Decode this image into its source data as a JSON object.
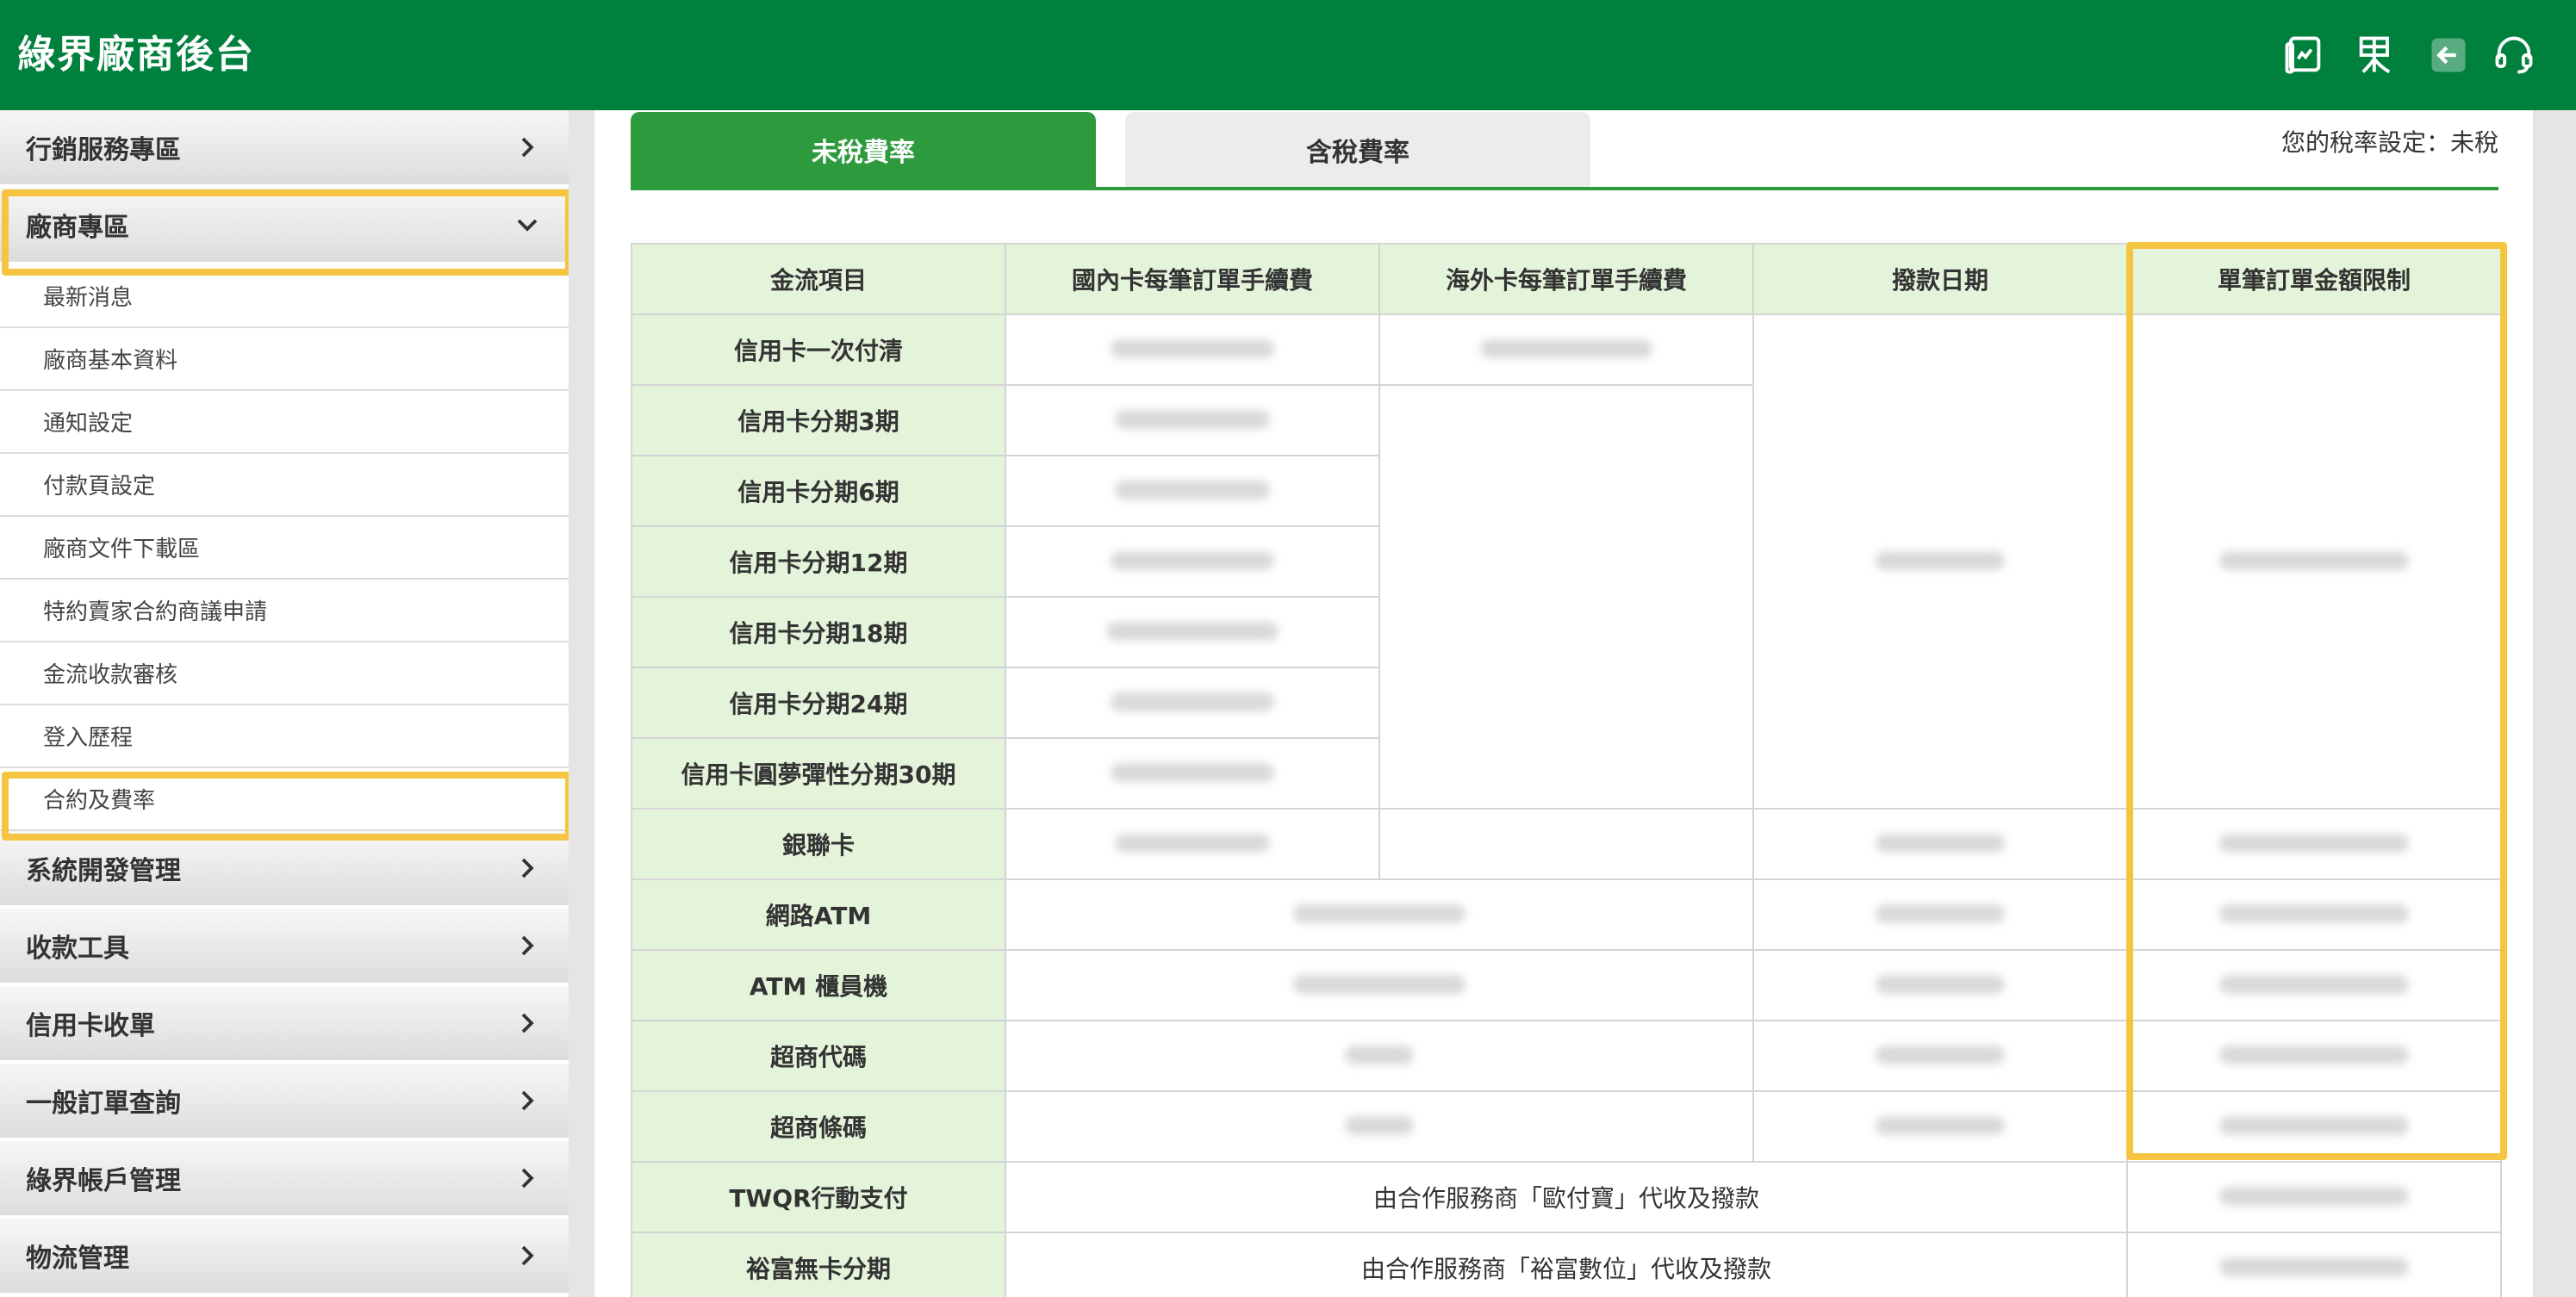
{
  "header": {
    "brand": "綠界廠商後台",
    "icons": [
      "dashboard-icon",
      "translate-icon",
      "logout-icon",
      "support-icon"
    ]
  },
  "sidebar": {
    "sections_top": [
      {
        "label": "行銷服務專區",
        "expanded": false
      },
      {
        "label": "廠商專區",
        "expanded": true
      }
    ],
    "sub_items": [
      "最新消息",
      "廠商基本資料",
      "通知設定",
      "付款頁設定",
      "廠商文件下載區",
      "特約賣家合約商議申請",
      "金流收款審核",
      "登入歷程",
      "合約及費率"
    ],
    "selected_sub_item": "合約及費率",
    "sections_bottom": [
      {
        "label": "系統開發管理"
      },
      {
        "label": "收款工具"
      },
      {
        "label": "信用卡收單"
      },
      {
        "label": "一般訂單查詢"
      },
      {
        "label": "綠界帳戶管理"
      },
      {
        "label": "物流管理"
      }
    ]
  },
  "tabs": [
    {
      "label": "未稅費率",
      "active": true
    },
    {
      "label": "含稅費率",
      "active": false
    }
  ],
  "tax_setting": "您的稅率設定：未稅",
  "table": {
    "headers": [
      "金流項目",
      "國內卡每筆訂單手續費",
      "海外卡每筆訂單手續費",
      "撥款日期",
      "單筆訂單金額限制"
    ],
    "rows": [
      "信用卡一次付清",
      "信用卡分期3期",
      "信用卡分期6期",
      "信用卡分期12期",
      "信用卡分期18期",
      "信用卡分期24期",
      "信用卡圓夢彈性分期30期",
      "銀聯卡",
      "網路ATM",
      "ATM 櫃員機",
      "超商代碼",
      "超商條碼",
      "TWQR行動支付",
      "裕富無卡分期"
    ],
    "twqr_note": "由合作服務商「歐付寶」代收及撥款",
    "yufu_note": "由合作服務商「裕富數位」代收及撥款"
  },
  "colors": {
    "brand_green": "#00803d",
    "tab_green": "#2e9a3e",
    "header_cell": "#e3f4da",
    "highlight": "#f5c542"
  }
}
